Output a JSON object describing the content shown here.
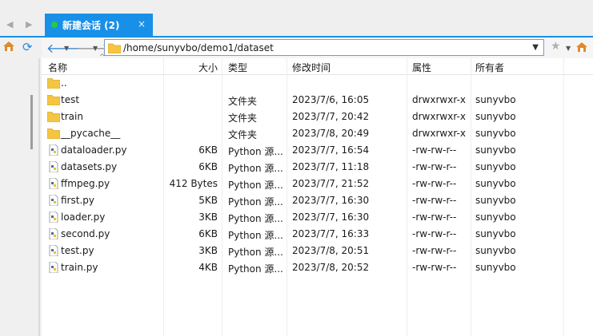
{
  "tab": {
    "title": "新建会话 (2)",
    "close": "×"
  },
  "address": {
    "path": "/home/sunyvbo/demo1/dataset"
  },
  "columns": {
    "name": "名称",
    "size": "大小",
    "type": "类型",
    "mtime": "修改时间",
    "perm": "属性",
    "owner": "所有者"
  },
  "files": [
    {
      "icon": "folder-icon",
      "name": "..",
      "size": "",
      "type": "",
      "mtime": "",
      "perm": "",
      "owner": ""
    },
    {
      "icon": "folder-icon",
      "name": "test",
      "size": "",
      "type": "文件夹",
      "mtime": "2023/7/6, 16:05",
      "perm": "drwxrwxr-x",
      "owner": "sunyvbo"
    },
    {
      "icon": "folder-icon",
      "name": "train",
      "size": "",
      "type": "文件夹",
      "mtime": "2023/7/7, 20:42",
      "perm": "drwxrwxr-x",
      "owner": "sunyvbo"
    },
    {
      "icon": "folder-icon",
      "name": "__pycache__",
      "size": "",
      "type": "文件夹",
      "mtime": "2023/7/8, 20:49",
      "perm": "drwxrwxr-x",
      "owner": "sunyvbo"
    },
    {
      "icon": "python-file-icon",
      "name": "dataloader.py",
      "size": "6KB",
      "type": "Python 源...",
      "mtime": "2023/7/7, 16:54",
      "perm": "-rw-rw-r--",
      "owner": "sunyvbo"
    },
    {
      "icon": "python-file-icon",
      "name": "datasets.py",
      "size": "6KB",
      "type": "Python 源...",
      "mtime": "2023/7/7, 11:18",
      "perm": "-rw-rw-r--",
      "owner": "sunyvbo"
    },
    {
      "icon": "python-file-icon",
      "name": "ffmpeg.py",
      "size": "412 Bytes",
      "type": "Python 源...",
      "mtime": "2023/7/7, 21:52",
      "perm": "-rw-rw-r--",
      "owner": "sunyvbo"
    },
    {
      "icon": "python-file-icon",
      "name": "first.py",
      "size": "5KB",
      "type": "Python 源...",
      "mtime": "2023/7/7, 16:30",
      "perm": "-rw-rw-r--",
      "owner": "sunyvbo"
    },
    {
      "icon": "python-file-icon",
      "name": "loader.py",
      "size": "3KB",
      "type": "Python 源...",
      "mtime": "2023/7/7, 16:30",
      "perm": "-rw-rw-r--",
      "owner": "sunyvbo"
    },
    {
      "icon": "python-file-icon",
      "name": "second.py",
      "size": "6KB",
      "type": "Python 源...",
      "mtime": "2023/7/7, 16:33",
      "perm": "-rw-rw-r--",
      "owner": "sunyvbo"
    },
    {
      "icon": "python-file-icon",
      "name": "test.py",
      "size": "3KB",
      "type": "Python 源...",
      "mtime": "2023/7/8, 20:51",
      "perm": "-rw-rw-r--",
      "owner": "sunyvbo"
    },
    {
      "icon": "python-file-icon",
      "name": "train.py",
      "size": "4KB",
      "type": "Python 源...",
      "mtime": "2023/7/8, 20:52",
      "perm": "-rw-rw-r--",
      "owner": "sunyvbo"
    }
  ],
  "colors": {
    "accent": "#1890e8",
    "folder": "#f5c542",
    "status_dot": "#27c93f"
  }
}
